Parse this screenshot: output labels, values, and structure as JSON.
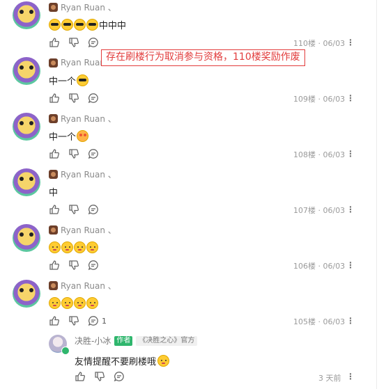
{
  "comments": [
    {
      "username": "Ryan Ruan 、",
      "text": "中中中",
      "emoji_prefix": [
        "sunglasses-emoji",
        "sunglasses-emoji",
        "sunglasses-emoji",
        "sunglasses-emoji"
      ],
      "meta": "110楼 · 06/03"
    },
    {
      "username": "Ryan Ruan",
      "text": "中一个",
      "emoji_suffix": "sunglasses-emoji",
      "meta": "109楼 · 06/03"
    },
    {
      "username": "Ryan Ruan 、",
      "text": "中一个",
      "emoji_suffix": "love-emoji",
      "meta": "108楼 · 06/03"
    },
    {
      "username": "Ryan Ruan 、",
      "text": "中",
      "meta": "107楼 · 06/03"
    },
    {
      "username": "Ryan Ruan 、",
      "text": "",
      "emoji_prefix": [
        "blush-emoji",
        "blush-emoji",
        "blush-emoji",
        "blush-emoji"
      ],
      "meta": "106楼 · 06/03"
    },
    {
      "username": "Ryan Ruan 、",
      "text": "",
      "emoji_prefix": [
        "blush-emoji",
        "blush-emoji",
        "blush-emoji",
        "blush-emoji"
      ],
      "meta": "105楼 · 06/03",
      "reply_count": "1"
    }
  ],
  "annotation": "存在刷楼行为取消参与资格，110楼奖励作废",
  "reply": {
    "username": "决胜-小冰",
    "tag_author": "作者",
    "tag_official": "《决胜之心》官方",
    "text": "友情提醒不要刷楼哦",
    "emoji": "hug-emoji",
    "meta": "3 天前"
  },
  "icons": {
    "like": "thumbs-up-icon",
    "dislike": "thumbs-down-icon",
    "reply": "comment-icon",
    "more": "more-dots-icon"
  },
  "colors": {
    "annotation": "#e23b3b",
    "author_tag": "#2fb66d"
  }
}
